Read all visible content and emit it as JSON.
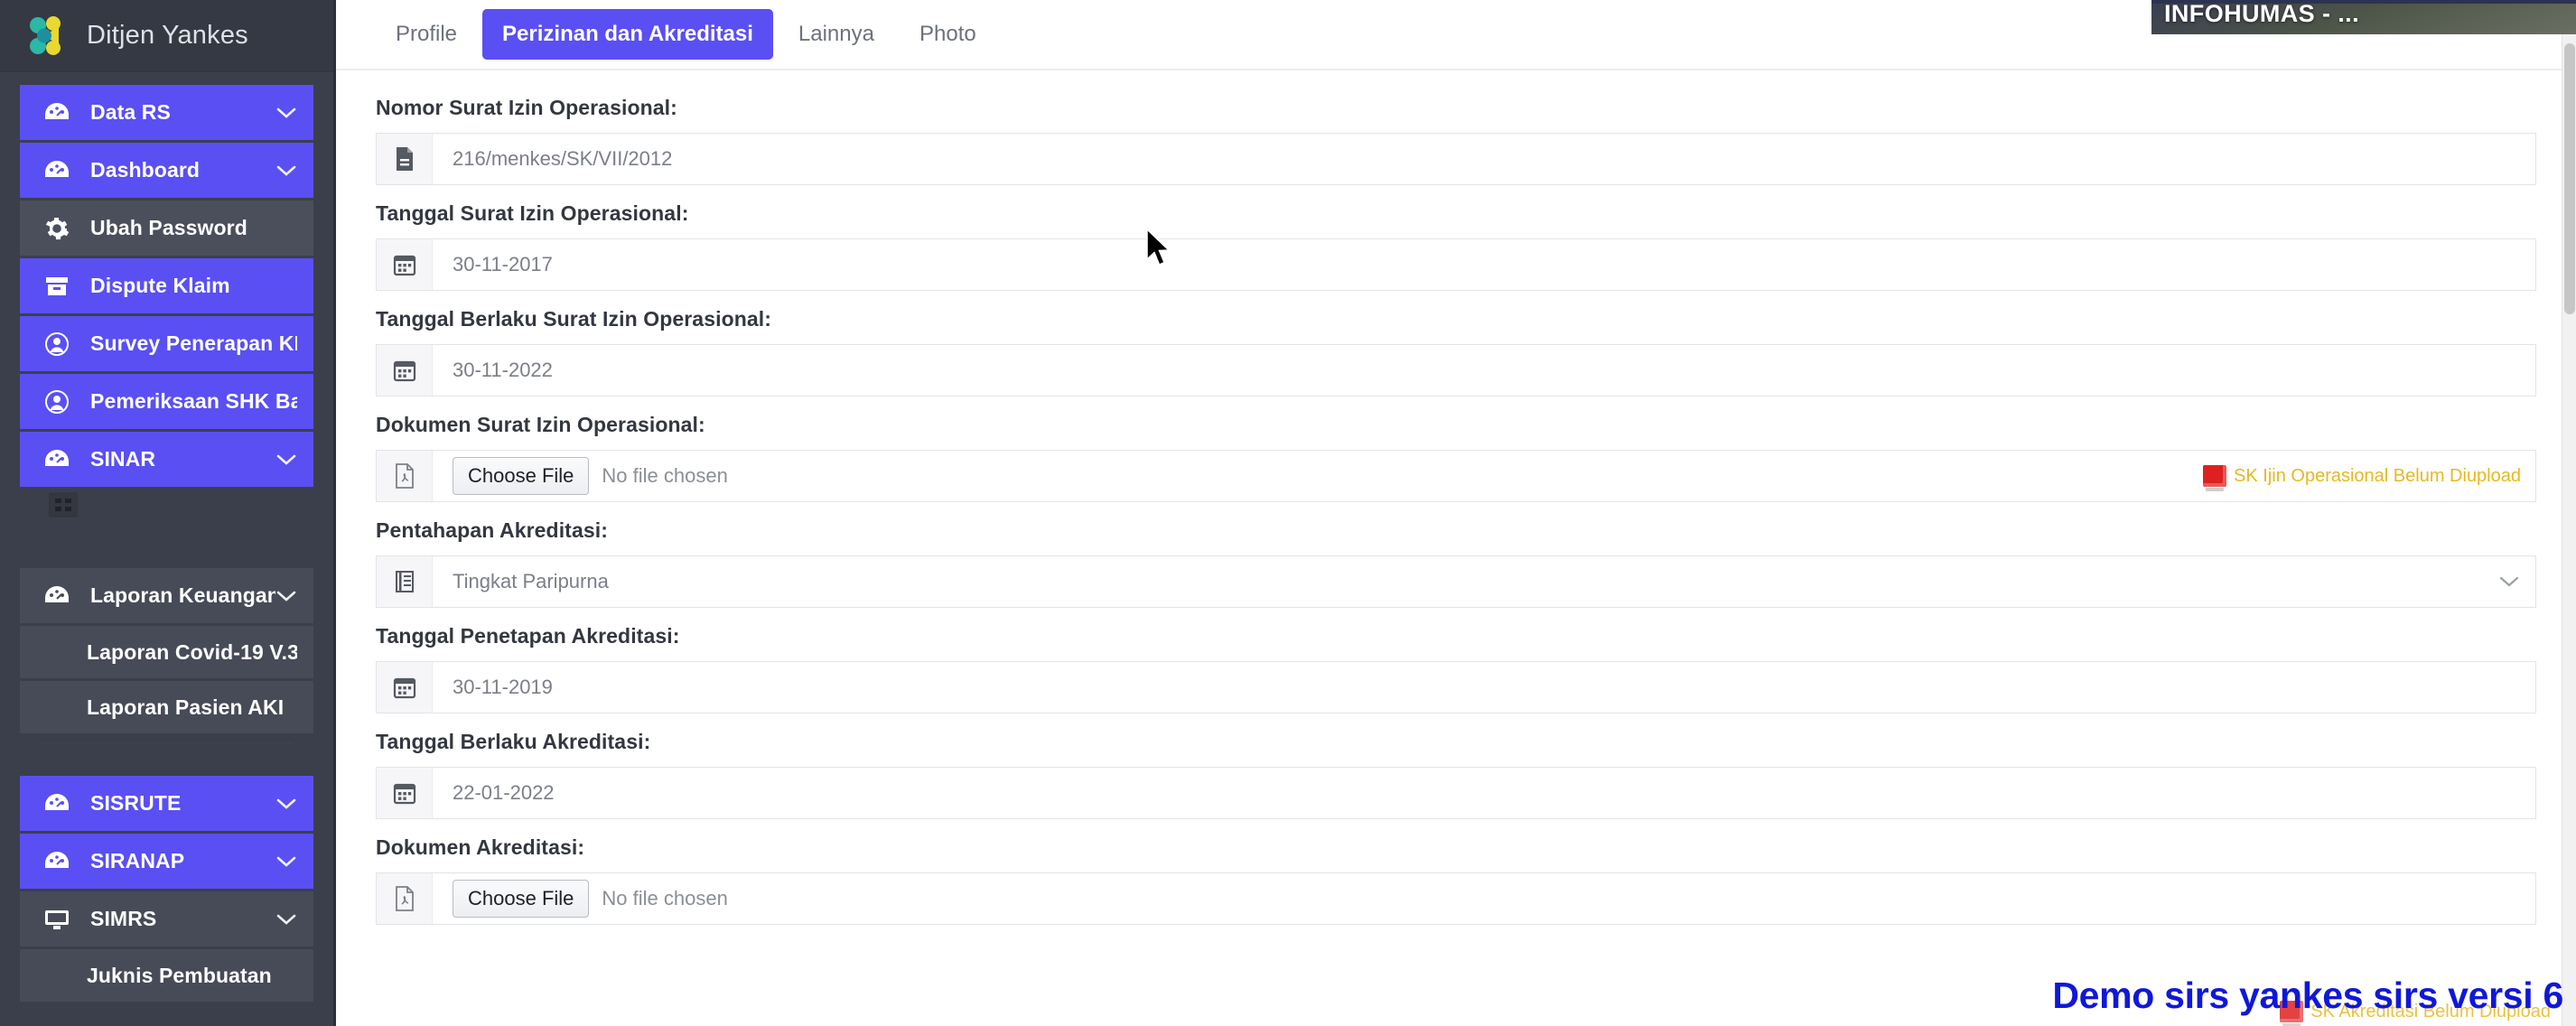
{
  "sidebar": {
    "brand": {
      "title": "Ditjen Yankes",
      "logo_icon": "yankes-logo-icon"
    },
    "items": [
      {
        "label": "Data RS",
        "icon": "dashboard-gauge-icon",
        "style": "accent",
        "caret": true
      },
      {
        "label": "Dashboard",
        "icon": "dashboard-gauge-icon",
        "style": "accent",
        "caret": true
      },
      {
        "label": "Ubah Password",
        "icon": "gear-icon",
        "style": "muted",
        "caret": false
      },
      {
        "label": "Dispute Klaim",
        "icon": "archive-box-icon",
        "style": "accent",
        "caret": false
      },
      {
        "label": "Survey Penerapan KRIS",
        "icon": "user-circle-icon",
        "style": "accent",
        "caret": false
      },
      {
        "label": "Pemeriksaan SHK Bayi",
        "icon": "user-circle-icon",
        "style": "accent",
        "caret": false
      },
      {
        "label": "SINAR",
        "icon": "dashboard-gauge-icon",
        "style": "accent",
        "caret": true
      },
      {
        "label": "Laporan Keuangan",
        "icon": "dashboard-gauge-icon",
        "style": "plain",
        "caret": true
      },
      {
        "label": "Laporan Covid-19 V.3",
        "icon": "",
        "style": "sub",
        "caret": false
      },
      {
        "label": "Laporan Pasien AKI",
        "icon": "",
        "style": "sub",
        "caret": false
      },
      {
        "label": "SISRUTE",
        "icon": "dashboard-gauge-icon",
        "style": "accent",
        "caret": true
      },
      {
        "label": "SIRANAP",
        "icon": "dashboard-gauge-icon",
        "style": "accent",
        "caret": true
      },
      {
        "label": "SIMRS",
        "icon": "monitor-icon",
        "style": "plain",
        "caret": true
      },
      {
        "label": "Juknis Pembuatan",
        "icon": "",
        "style": "sub",
        "caret": false
      }
    ]
  },
  "tabs": [
    {
      "label": "Profile",
      "active": false
    },
    {
      "label": "Perizinan dan Akreditasi",
      "active": true
    },
    {
      "label": "Lainnya",
      "active": false
    },
    {
      "label": "Photo",
      "active": false
    }
  ],
  "form": {
    "fields": [
      {
        "label": "Nomor Surat Izin Operasional:",
        "value": "216/menkes/SK/VII/2012",
        "icon": "document-icon",
        "type": "text"
      },
      {
        "label": "Tanggal Surat Izin Operasional:",
        "value": "30-11-2017",
        "icon": "calendar-icon",
        "type": "date"
      },
      {
        "label": "Tanggal Berlaku Surat Izin Operasional:",
        "value": "30-11-2022",
        "icon": "calendar-icon",
        "type": "date"
      },
      {
        "label": "Dokumen Surat Izin Operasional:",
        "icon": "pdf-file-icon",
        "type": "file",
        "button_label": "Choose File",
        "file_status": "No file chosen",
        "warning": "SK Ijin Operasional Belum Diupload"
      },
      {
        "label": "Pentahapan Akreditasi:",
        "value": "Tingkat Paripurna",
        "icon": "list-icon",
        "type": "select"
      },
      {
        "label": "Tanggal Penetapan Akreditasi:",
        "value": "30-11-2019",
        "icon": "calendar-icon",
        "type": "date"
      },
      {
        "label": "Tanggal Berlaku Akreditasi:",
        "value": "22-01-2022",
        "icon": "calendar-icon",
        "type": "date"
      },
      {
        "label": "Dokumen Akreditasi:",
        "icon": "pdf-file-icon",
        "type": "file",
        "button_label": "Choose File",
        "file_status": "No file chosen",
        "warning": "SK Akreditasi Belum Diupload"
      }
    ]
  },
  "overlays": {
    "video_title": "INFOHUMAS - ...",
    "watermark": "Demo sirs yankes sirs versi 6"
  },
  "colors": {
    "sidebar_bg": "#3b3f4c",
    "accent": "#5a4ff3",
    "warning_text": "#e6b822",
    "watermark_blue": "#1018d8"
  }
}
